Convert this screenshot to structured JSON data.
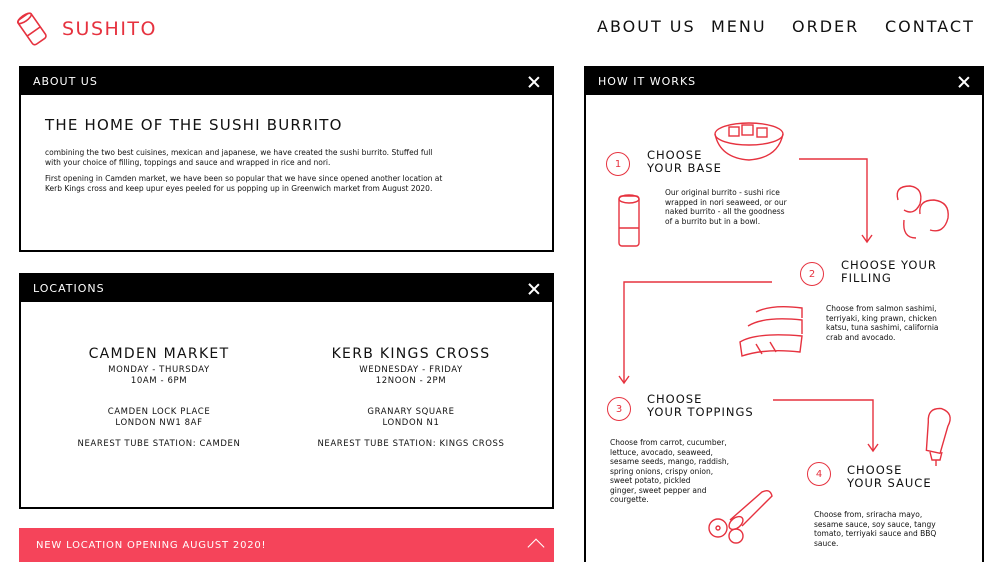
{
  "brand": {
    "name": "SUSHITO"
  },
  "nav": {
    "about": "ABOUT US",
    "menu": "MENU",
    "order": "ORDER",
    "contact": "CONTACT"
  },
  "about": {
    "bar_title": "ABOUT US",
    "heading": "THE HOME OF THE SUSHI BURRITO",
    "p1_line1": "combining the two best cuisines, mexican and japanese, we have created the sushi burrito.   Stuffed full",
    "p1_line2": "with your choice of filling, toppings and sauce and wrapped in rice and nori.",
    "p2_line1": "First opening in Camden market, we have been so popular that we have since opened another location at",
    "p2_line2": "Kerb Kings cross and keep upur eyes peeled for us popping up in Greenwich market from August 2020."
  },
  "locations": {
    "bar_title": "LOCATIONS",
    "items": [
      {
        "name": "CAMDEN MARKET",
        "days": "MONDAY - THURSDAY",
        "hours": "10AM - 6PM",
        "addr1": "CAMDEN LOCK PLACE",
        "addr2": "LONDON NW1 8AF",
        "tube": "NEAREST TUBE STATION: CAMDEN"
      },
      {
        "name": "KERB KINGS CROSS",
        "days": "WEDNESDAY - FRIDAY",
        "hours": "12NOON - 2PM",
        "addr1": "GRANARY SQUARE",
        "addr2": "LONDON N1",
        "tube": "NEAREST TUBE STATION: KINGS CROSS"
      }
    ]
  },
  "banner": {
    "text": "NEW LOCATION OPENING AUGUST 2020!"
  },
  "how": {
    "bar_title": "HOW IT WORKS",
    "steps": [
      {
        "num": "1",
        "t1": "CHOOSE",
        "t2": "YOUR BASE",
        "d": [
          "Our original burrito - sushi rice",
          "wrapped in nori seaweed, or our",
          "naked burrito - all the goodness",
          "of a burrito but in a bowl."
        ]
      },
      {
        "num": "2",
        "t1": "CHOOSE YOUR",
        "t2": "FILLING",
        "d": [
          "Choose from salmon sashimi,",
          "terriyaki, king prawn, chicken",
          "katsu, tuna sashimi, california",
          "crab and avocado."
        ]
      },
      {
        "num": "3",
        "t1": "CHOOSE",
        "t2": "YOUR TOPPINGS",
        "d": [
          "Choose from carrot, cucumber,",
          "lettuce, avocado, seaweed,",
          "sesame seeds, mango, raddish,",
          "spring onions, crispy onion,",
          "sweet potato, pickled",
          "ginger, sweet pepper and",
          "courgette."
        ]
      },
      {
        "num": "4",
        "t1": "CHOOSE",
        "t2": "YOUR SAUCE",
        "d": [
          "Choose from, sriracha mayo,",
          "sesame sauce, soy sauce, tangy",
          "tomato, terriyaki sauce and BBQ",
          "sauce."
        ]
      }
    ]
  },
  "colors": {
    "accent": "#e6323f",
    "banner": "#f5445a",
    "bar": "#000000"
  },
  "icons": [
    "sushi-burrito-logo-icon",
    "close-icon",
    "chevron-up-icon",
    "bowl-icon",
    "burrito-icon",
    "prawn-icon",
    "salmon-icon",
    "cucumber-icon",
    "sauce-bottle-icon"
  ]
}
